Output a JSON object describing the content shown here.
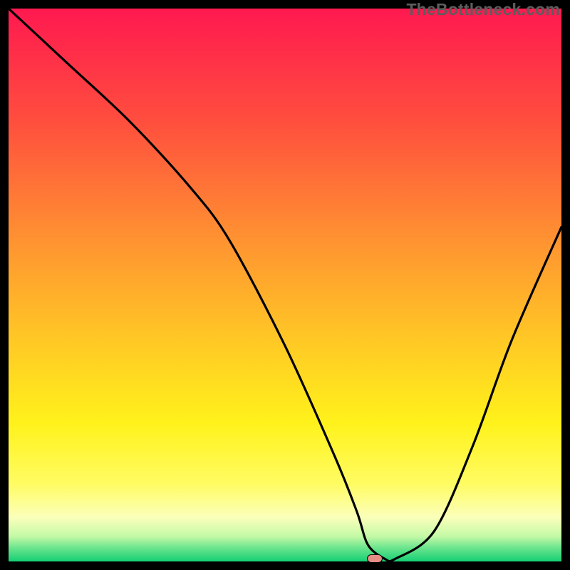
{
  "watermark": "TheBottleneck.com",
  "chart_data": {
    "type": "line",
    "title": "",
    "xlabel": "",
    "ylabel": "",
    "xlim": [
      0,
      100
    ],
    "ylim": [
      0,
      100
    ],
    "grid": false,
    "series": [
      {
        "name": "curve",
        "x": [
          0,
          10,
          22,
          33,
          40,
          50,
          59,
          63,
          65,
          68,
          70,
          77,
          84,
          91,
          100
        ],
        "values": [
          100,
          90.7,
          79.5,
          67.5,
          58,
          39,
          19,
          9,
          3,
          0.5,
          0.5,
          5.5,
          21,
          40,
          60.5
        ]
      }
    ],
    "marker": {
      "x": 66.2,
      "y": 0.5
    },
    "gradient_stops": [
      {
        "offset": 0,
        "color": "#ff1950"
      },
      {
        "offset": 0.2,
        "color": "#ff4d3e"
      },
      {
        "offset": 0.42,
        "color": "#ff9331"
      },
      {
        "offset": 0.6,
        "color": "#ffc825"
      },
      {
        "offset": 0.75,
        "color": "#fff21b"
      },
      {
        "offset": 0.86,
        "color": "#fffc63"
      },
      {
        "offset": 0.92,
        "color": "#fbffba"
      },
      {
        "offset": 0.955,
        "color": "#c3f9a6"
      },
      {
        "offset": 0.975,
        "color": "#6de58e"
      },
      {
        "offset": 1.0,
        "color": "#15cf74"
      }
    ]
  }
}
